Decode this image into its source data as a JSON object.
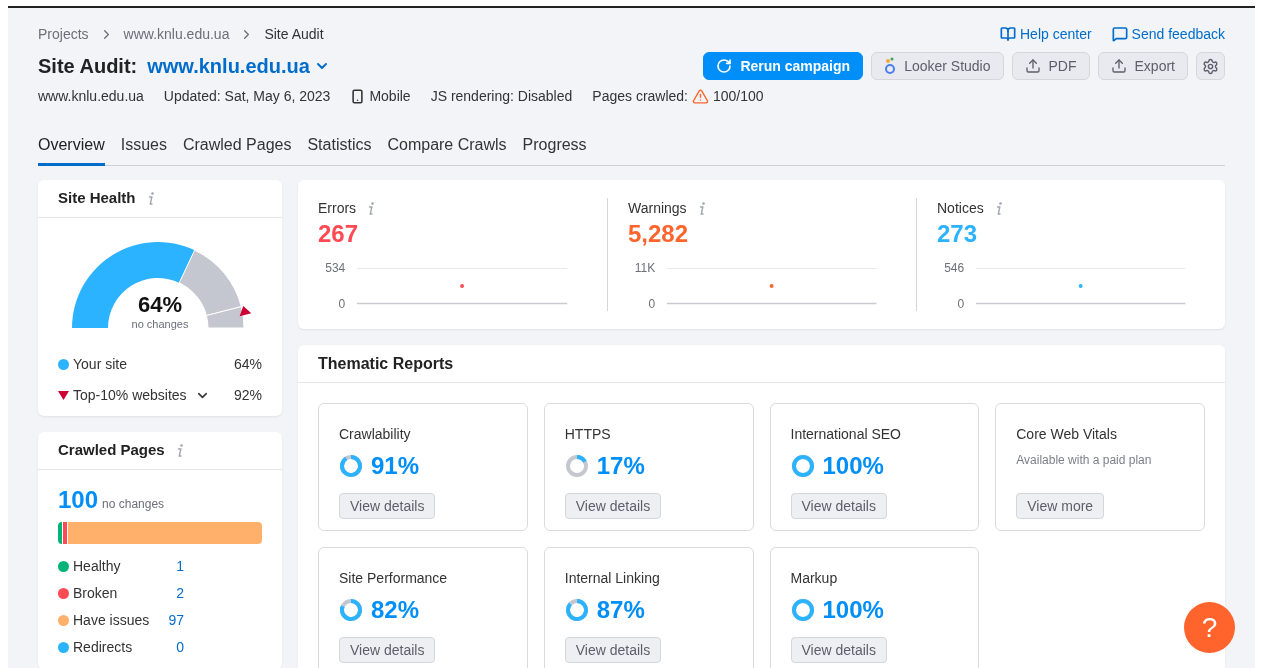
{
  "breadcrumbs": [
    "Projects",
    "www.knlu.edu.ua",
    "Site Audit"
  ],
  "header_links": [
    {
      "kind": "help",
      "label": "Help center"
    },
    {
      "kind": "feedback",
      "label": "Send feedback"
    }
  ],
  "title": {
    "label": "Site Audit:",
    "domain": "www.knlu.edu.ua"
  },
  "actions": [
    {
      "kind": "rerun",
      "label": "Rerun campaign"
    },
    {
      "kind": "looker",
      "label": "Looker Studio"
    },
    {
      "kind": "upload",
      "label": "PDF"
    },
    {
      "kind": "upload",
      "label": "Export"
    },
    {
      "kind": "settings"
    }
  ],
  "meta": [
    {
      "kind": "text",
      "label": "www.knlu.edu.ua"
    },
    {
      "kind": "text",
      "label": "Updated: Sat, May 6, 2023"
    },
    {
      "kind": "device",
      "label": "Mobile"
    },
    {
      "kind": "text",
      "label": "JS rendering: Disabled"
    },
    {
      "kind": "warning",
      "label": "Pages crawled:",
      "value": "100/100"
    }
  ],
  "tabs": [
    {
      "label": "Overview",
      "selected": true
    },
    {
      "label": "Issues",
      "selected": false
    },
    {
      "label": "Crawled Pages",
      "selected": false
    },
    {
      "label": "Statistics",
      "selected": false
    },
    {
      "label": "Compare Crawls",
      "selected": false
    },
    {
      "label": "Progress",
      "selected": false
    }
  ],
  "site_health": {
    "title": "Site Health",
    "value": "64%",
    "note": "no changes",
    "level": 0.64,
    "legend": [
      {
        "kind": "dot",
        "label": "Your site",
        "value": "64%",
        "color": "#2bb3ff"
      },
      {
        "kind": "triangle",
        "label": "Top-10% websites",
        "value": "92%",
        "color": "#cc0033"
      }
    ]
  },
  "crawled_pages": {
    "title": "Crawled Pages",
    "total": "100",
    "note": "no changes",
    "items": [
      {
        "label": "Healthy",
        "value": "1",
        "color": "#00b377"
      },
      {
        "label": "Broken",
        "value": "2",
        "color": "#ff4953"
      },
      {
        "label": "Have issues",
        "value": "97",
        "color": "#ffb06b"
      },
      {
        "label": "Redirects",
        "value": "0",
        "color": "#2bb3ff"
      }
    ]
  },
  "summary": [
    {
      "label": "Errors",
      "value": "267",
      "color": "#ff4953",
      "axis_labels": [
        "534",
        "0"
      ]
    },
    {
      "label": "Warnings",
      "value": "5,282",
      "color": "#ff642d",
      "axis_labels": [
        "11K",
        "0"
      ]
    },
    {
      "label": "Notices",
      "value": "273",
      "color": "#2bb3ff",
      "axis_labels": [
        "546",
        "0"
      ]
    }
  ],
  "thematic_reports": {
    "title": "Thematic Reports",
    "reports": [
      {
        "kind": "score",
        "name": "Crawlability",
        "value": "91%",
        "button": "View details"
      },
      {
        "kind": "score",
        "name": "HTTPS",
        "value": "17%",
        "button": "View details"
      },
      {
        "kind": "score",
        "name": "International SEO",
        "value": "100%",
        "button": "View details"
      },
      {
        "kind": "paid",
        "name": "Core Web Vitals",
        "note": "Available with a paid plan",
        "button": "View more"
      },
      {
        "kind": "score",
        "name": "Site Performance",
        "value": "82%",
        "button": "View details"
      },
      {
        "kind": "score",
        "name": "Internal Linking",
        "value": "87%",
        "button": "View details"
      },
      {
        "kind": "score",
        "name": "Markup",
        "value": "100%",
        "button": "View details"
      }
    ]
  },
  "help_button": "?"
}
